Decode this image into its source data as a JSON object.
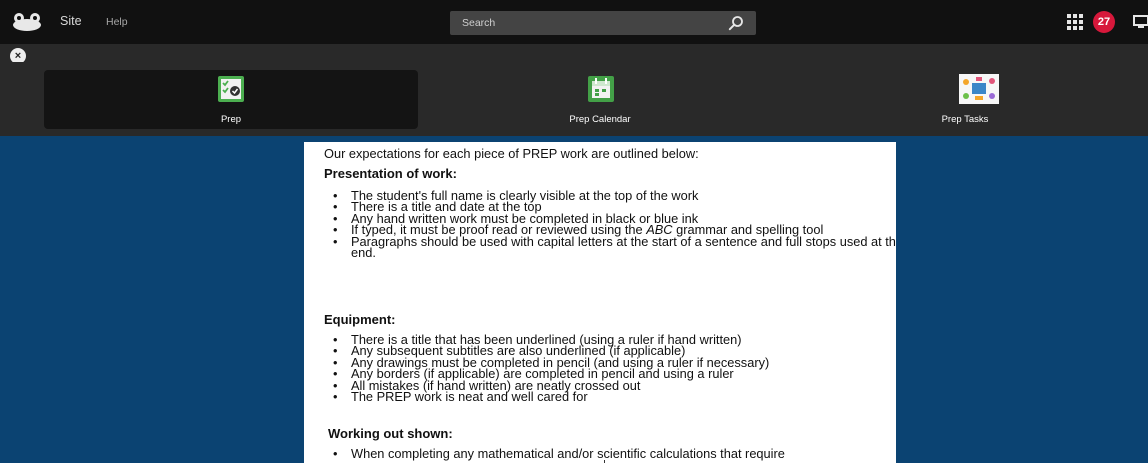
{
  "topbar": {
    "site_label": "Site",
    "help_label": "Help",
    "search_placeholder": "Search",
    "notification_count": "27",
    "icons": [
      "frog-logo-icon",
      "search-icon",
      "apps-grid-icon",
      "message-icon"
    ]
  },
  "strip": {
    "close_label": "×"
  },
  "toolbar": {
    "items": [
      {
        "label": "Prep",
        "icon": "checklist-icon",
        "active": true
      },
      {
        "label": "Prep Calendar",
        "icon": "calendar-icon",
        "active": false
      },
      {
        "label": "Prep Tasks",
        "icon": "tasks-illustration-icon",
        "active": false
      }
    ]
  },
  "document": {
    "intro": "Our expectations for each piece of PREP work are outlined below:",
    "sections": [
      {
        "heading": "Presentation of work:",
        "items": [
          "The student's full name is clearly visible at the top of the work",
          "There is a title and date at the top",
          "Any hand written work must be completed in black or blue ink",
          {
            "before": "If typed, it must be proof read or reviewed using the ",
            "emph": "ABC",
            "after": " grammar and spelling tool"
          },
          "Paragraphs should be used with capital letters at the start of a sentence and full stops used at the end."
        ]
      },
      {
        "heading": "Equipment:",
        "items": [
          "There is a title that has been underlined (using a ruler if hand written)",
          "Any subsequent subtitles are also underlined (if applicable)",
          "Any drawings must be completed in pencil (and using a ruler if necessary)",
          "Any borders (if applicable) are completed in pencil and using a ruler",
          "All mistakes (if hand written) are neatly crossed out",
          "The PREP work is neat and well cared for"
        ]
      },
      {
        "heading": "Working out shown:",
        "items": [
          "When completing any mathematical and/or scientific calculations that require"
        ]
      }
    ]
  },
  "colors": {
    "topbar_bg": "#111111",
    "toolbar_bg": "#292929",
    "page_bg": "#0b4372",
    "badge_bg": "#d7183b"
  }
}
